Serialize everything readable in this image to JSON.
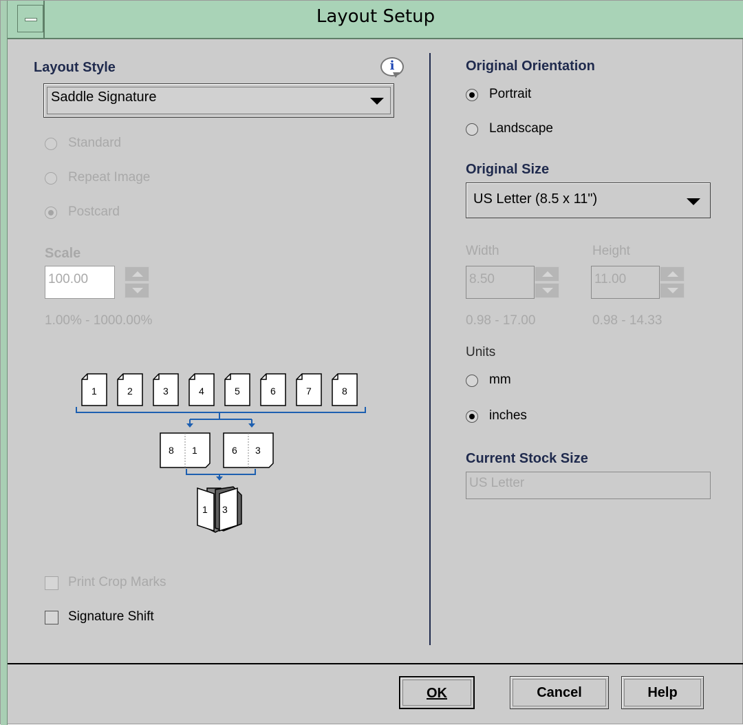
{
  "window": {
    "title": "Layout Setup"
  },
  "layout_style": {
    "label": "Layout Style",
    "selected": "Saddle Signature",
    "options": [
      "Standard",
      "Repeat Image",
      "Postcard"
    ],
    "selected_option": "Postcard"
  },
  "scale": {
    "label": "Scale",
    "value": "100.00",
    "range": "1.00% - 1000.00%"
  },
  "diagram": {
    "row1": [
      "1",
      "2",
      "3",
      "4",
      "5",
      "6",
      "7",
      "8"
    ],
    "row2": [
      [
        "8",
        "1"
      ],
      [
        "6",
        "3"
      ]
    ],
    "row3": [
      "1",
      "3"
    ]
  },
  "options": {
    "print_crop_marks": "Print Crop Marks",
    "signature_shift": "Signature Shift"
  },
  "orientation": {
    "label": "Original Orientation",
    "portrait": "Portrait",
    "landscape": "Landscape",
    "selected": "Portrait"
  },
  "original_size": {
    "label": "Original Size",
    "selected": "US Letter (8.5 x 11\")"
  },
  "width": {
    "label": "Width",
    "value": "8.50",
    "range": "0.98 - 17.00"
  },
  "height": {
    "label": "Height",
    "value": "11.00",
    "range": "0.98 - 14.33"
  },
  "units": {
    "label": "Units",
    "mm": "mm",
    "inches": "inches",
    "selected": "inches"
  },
  "stock": {
    "label": "Current Stock Size",
    "value": "US Letter"
  },
  "buttons": {
    "ok": "OK",
    "cancel": "Cancel",
    "help": "Help"
  },
  "icons": {
    "info": "info-icon",
    "system_menu": "system-menu-icon"
  }
}
